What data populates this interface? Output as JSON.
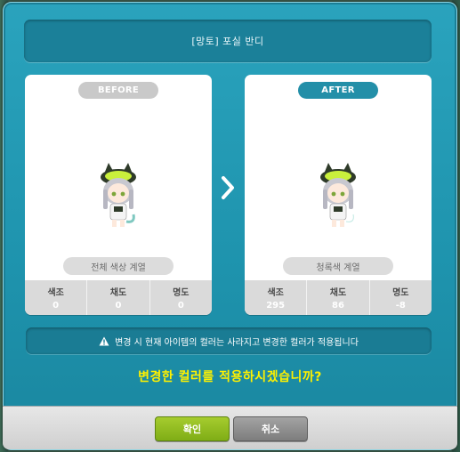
{
  "dialog": {
    "title": "[망토] 포실 반디",
    "before": {
      "tag": "BEFORE",
      "palette": "전체 색상 계열",
      "stats": [
        {
          "label": "색조",
          "value": "0"
        },
        {
          "label": "채도",
          "value": "0"
        },
        {
          "label": "명도",
          "value": "0"
        }
      ]
    },
    "after": {
      "tag": "AFTER",
      "palette": "청록색 계열",
      "stats": [
        {
          "label": "색조",
          "value": "295"
        },
        {
          "label": "채도",
          "value": "86"
        },
        {
          "label": "명도",
          "value": "-8"
        }
      ]
    },
    "notice": "변경 시 현재 아이템의 컬러는 사라지고 변경한 컬러가 적용됩니다",
    "question": "변경한 컬러를 적용하시겠습니까?",
    "ok_label": "확인",
    "cancel_label": "취소"
  },
  "colors": {
    "accent": "#1e93ad",
    "question": "#fff100",
    "ok": "#8fbc1f",
    "cancel": "#8a8a8a"
  }
}
